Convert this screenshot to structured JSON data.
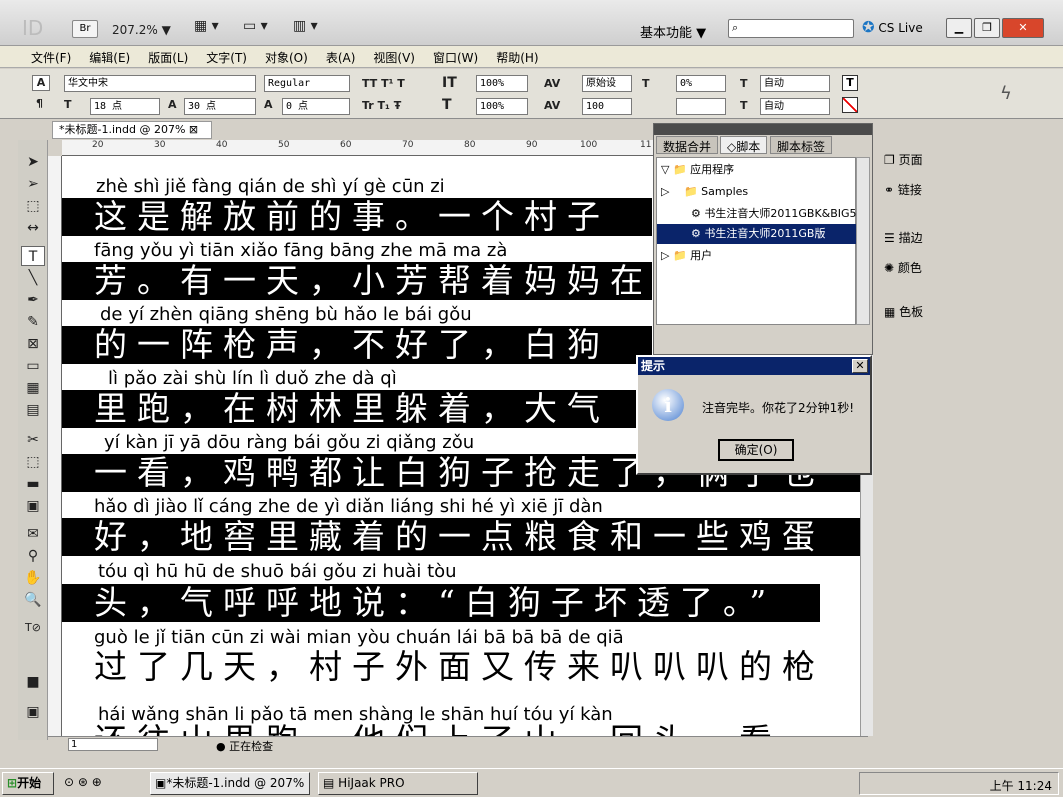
{
  "appbar": {
    "logo": "ID",
    "br": "Br",
    "zoom": "207.2% ▼",
    "workspace": "基本功能 ▼",
    "cslive": "CS Live",
    "win_min": "▭",
    "win_max": "▭",
    "win_close": "✕"
  },
  "menus": [
    "文件(F)",
    "编辑(E)",
    "版面(L)",
    "文字(T)",
    "对象(O)",
    "表(A)",
    "视图(V)",
    "窗口(W)",
    "帮助(H)"
  ],
  "control": {
    "font": "华文中宋",
    "style": "Regular",
    "size": "18 点",
    "leading": "30 点",
    "baseline": "0 点",
    "hscale": "100%",
    "vscale": "100%",
    "kerning": "原始设",
    "tracking": "100",
    "skew": "0%",
    "auto1": "自动",
    "auto2": "自动"
  },
  "document": {
    "tab": "*未标题-1.indd @ 207%",
    "ruler": [
      "20",
      "30",
      "40",
      "50",
      "60",
      "70",
      "80",
      "90",
      "100",
      "11"
    ],
    "lines": [
      {
        "pinyin": "zhè shì jiě fàng qián de shì      yí gè cūn zi",
        "hanzi": "这是解放前的事。一个村子"
      },
      {
        "pinyin": "fāng     yǒu yì tiān      xiǎo fāng bāng zhe mā ma zà",
        "hanzi": "芳。有一天，小芳帮着妈妈在"
      },
      {
        "pinyin": "de  yí zhèn qiāng shēng      bù hǎo le          bái gǒu",
        "hanzi": "的一阵枪声，不好了，白狗"
      },
      {
        "pinyin": "lì  pǎo       zài shù lín  lì  duǒ zhe          dà  qì",
        "hanzi": "里跑，在树林里躲着，大气"
      },
      {
        "pinyin": "yí  kàn        jī  yā  dōu ràng bái gǒu zi qiǎng zǒu",
        "hanzi": "一看，鸡鸭都让白狗子抢走了，俩了也"
      },
      {
        "pinyin": "hǎo      dì  jiào lǐ  cáng zhe  de  yì diǎn liáng shi  hé  yì  xiē  jī  dàn",
        "hanzi": "好，地窖里藏着的一点粮食和一些鸡蛋"
      },
      {
        "pinyin": "tóu       qì  hū  hū  de shuō          bái gǒu  zi huài tòu",
        "hanzi": "头，气呼呼地说：“白狗子坏透了。”"
      },
      {
        "pinyin": "guò  le   jǐ  tiān      cūn  zi  wài mian yòu chuán lái  bā  bā  bā  de qiā",
        "hanzi": "过了几天，村子外面又传来叭叭叭的枪"
      },
      {
        "pinyin": "hái wǎng shān  li  pǎo        tā  men shàng  le  shān        huí  tóu  yí  kàn",
        "hanzi": "还往山里跑，他们上了山，回头一看"
      }
    ]
  },
  "script_panel": {
    "tab1": "数据合并",
    "tab2": "◇脚本",
    "tab3": "脚本标签",
    "tree": [
      {
        "label": "应用程序",
        "level": 0,
        "open": true
      },
      {
        "label": "Samples",
        "level": 1,
        "open": false
      },
      {
        "label": "书生注音大师2011GBK&BIG5",
        "level": 2,
        "open": false
      },
      {
        "label": "书生注音大师2011GB版",
        "level": 2,
        "selected": true
      },
      {
        "label": "用户",
        "level": 0,
        "open": false
      }
    ]
  },
  "right_panel": {
    "items": [
      "页面",
      "链接",
      "描边",
      "颜色",
      "色板"
    ]
  },
  "dialog": {
    "title": "提示",
    "message": "注音完毕。你花了2分钟1秒!",
    "ok": "确定(O)"
  },
  "status": {
    "page": "1",
    "check": "正在检查"
  },
  "taskbar": {
    "start": "开始",
    "tasks": [
      "*未标题-1.indd @ 207%",
      "HiJaak PRO"
    ],
    "clock": "上午 11:24"
  }
}
